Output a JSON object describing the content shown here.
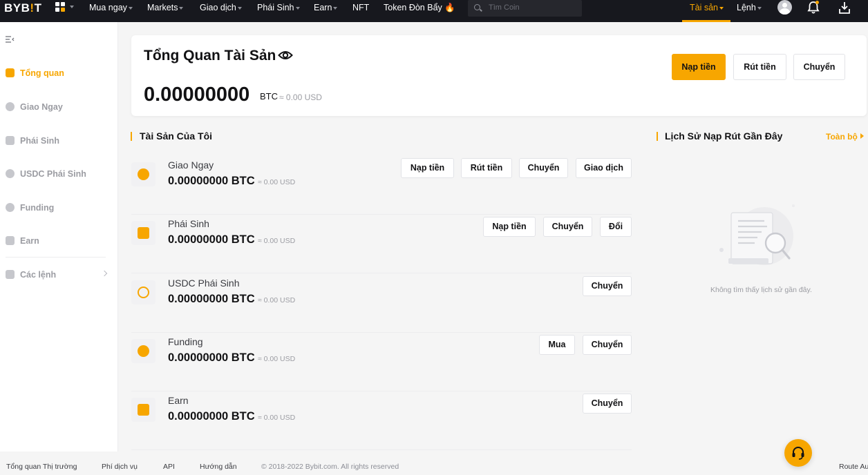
{
  "nav": {
    "logo_text": "BYB",
    "logo_mark": "!",
    "logo_tail": "T",
    "items": [
      {
        "label": "Mua ngay",
        "caret": true
      },
      {
        "label": "Markets",
        "caret": true
      },
      {
        "label": "Giao dịch",
        "caret": true
      },
      {
        "label": "Phái Sinh",
        "caret": true
      },
      {
        "label": "Earn",
        "caret": true
      },
      {
        "label": "NFT",
        "caret": false
      },
      {
        "label": "Token Đòn Bẩy 🔥",
        "caret": false
      }
    ],
    "search_placeholder": "Tìm Coin",
    "assets_label": "Tài sản",
    "orders_label": "Lệnh",
    "accent": "#f7a600"
  },
  "sidebar": {
    "items": [
      {
        "label": "Tổng quan",
        "icon": "wallet-icon",
        "active": true
      },
      {
        "label": "Giao Ngay",
        "icon": "coins-icon",
        "active": false
      },
      {
        "label": "Phái Sinh",
        "icon": "derivatives-icon",
        "active": false
      },
      {
        "label": "USDC Phái Sinh",
        "icon": "usdc-icon",
        "active": false
      },
      {
        "label": "Funding",
        "icon": "funding-icon",
        "active": false
      },
      {
        "label": "Earn",
        "icon": "piggy-bank-icon",
        "active": false
      },
      {
        "label": "Các lệnh",
        "icon": "orders-icon",
        "active": false
      }
    ]
  },
  "overview": {
    "title": "Tổng Quan Tài Sản",
    "amount": "0.00000000",
    "unit": "BTC",
    "usd": "≈ 0.00 USD",
    "deposit": "Nạp tiền",
    "withdraw": "Rút tiền",
    "transfer": "Chuyển"
  },
  "assets": {
    "title": "Tài Sản Của Tôi",
    "rows": [
      {
        "name": "Giao Ngay",
        "balance": "0.00000000 BTC",
        "usd": "≈ 0.00 USD",
        "icon": "coins-icon",
        "actions": [
          "Nạp tiền",
          "Rút tiền",
          "Chuyển",
          "Giao dịch"
        ]
      },
      {
        "name": "Phái Sinh",
        "balance": "0.00000000 BTC",
        "usd": "≈ 0.00 USD",
        "icon": "derivatives-icon",
        "actions": [
          "Nạp tiền",
          "Chuyển",
          "Đổi"
        ]
      },
      {
        "name": "USDC Phái Sinh",
        "balance": "0.00000000 BTC",
        "usd": "≈ 0.00 USD",
        "icon": "usdc-icon",
        "actions": [
          "Chuyển"
        ]
      },
      {
        "name": "Funding",
        "balance": "0.00000000 BTC",
        "usd": "≈ 0.00 USD",
        "icon": "funding-icon",
        "actions": [
          "Mua",
          "Chuyển"
        ]
      },
      {
        "name": "Earn",
        "balance": "0.00000000 BTC",
        "usd": "≈ 0.00 USD",
        "icon": "piggy-bank-icon",
        "actions": [
          "Chuyển"
        ]
      }
    ]
  },
  "history": {
    "title": "Lịch Sử Nạp Rút Gần Đây",
    "view_all": "Toàn bộ",
    "empty": "Không tìm thấy lịch sử gần đây."
  },
  "footer": {
    "links": [
      "Tổng quan Thị trường",
      "Phí dịch vụ",
      "API",
      "Hướng dẫn"
    ],
    "copyright": "© 2018-2022 Bybit.com. All rights reserved",
    "route": "Route Au"
  }
}
